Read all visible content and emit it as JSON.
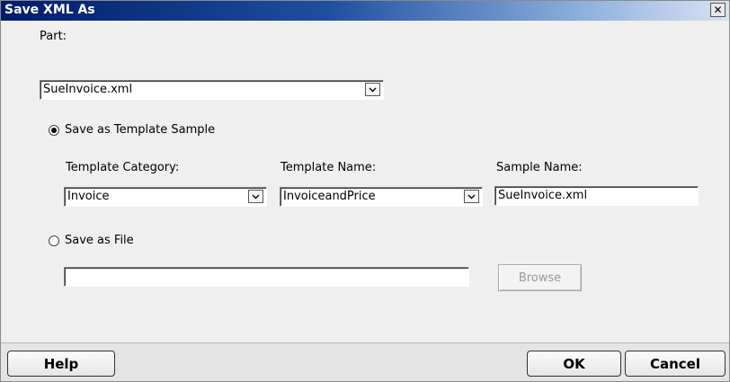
{
  "window": {
    "title": "Save XML As",
    "close_glyph": "✕"
  },
  "part": {
    "label": "Part:",
    "value": "SueInvoice.xml"
  },
  "options": {
    "template_sample_label": "Save as Template Sample",
    "template_sample_selected": true,
    "file_label": "Save as File",
    "file_selected": false
  },
  "template": {
    "category_label": "Template Category:",
    "category_value": "Invoice",
    "name_label": "Template Name:",
    "name_value": "InvoiceandPrice",
    "sample_label": "Sample Name:",
    "sample_value": "SueInvoice.xml"
  },
  "file": {
    "path_value": "",
    "browse_label": "Browse",
    "browse_enabled": false
  },
  "footer": {
    "help_label": "Help",
    "ok_label": "OK",
    "cancel_label": "Cancel"
  },
  "icons": {
    "dropdown": "chevron-down-icon",
    "close": "close-icon"
  }
}
